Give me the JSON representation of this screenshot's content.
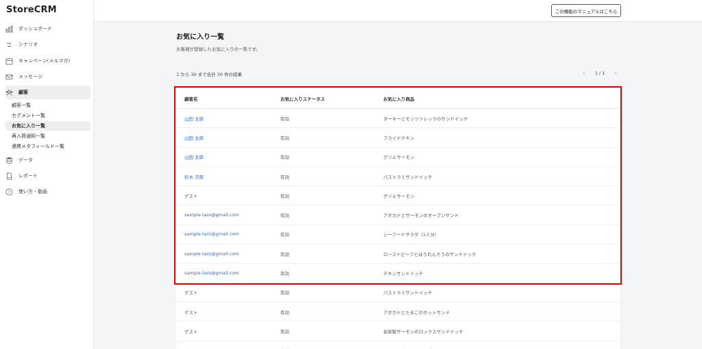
{
  "app": {
    "logo": "StoreCRM"
  },
  "sidebar": {
    "items": [
      {
        "label": "ダッシュボード",
        "icon": "bar-chart-icon"
      },
      {
        "label": "シナリオ",
        "icon": "scenario-icon"
      },
      {
        "label": "キャンペーン(メルマガ)",
        "icon": "calendar-icon"
      },
      {
        "label": "メッセージ",
        "icon": "mail-icon"
      },
      {
        "label": "顧客",
        "icon": "users-icon",
        "active": true
      },
      {
        "label": "データ",
        "icon": "database-icon"
      },
      {
        "label": "レポート",
        "icon": "report-icon"
      },
      {
        "label": "使い方・動画",
        "icon": "help-icon"
      }
    ],
    "sub_items": [
      {
        "label": "顧客一覧"
      },
      {
        "label": "セグメント一覧"
      },
      {
        "label": "お気に入り一覧",
        "active": true
      },
      {
        "label": "再入荷通知一覧"
      },
      {
        "label": "連携メタフィールド一覧"
      }
    ]
  },
  "topbar": {
    "manual_button": "この機能のマニュアルはこちら"
  },
  "main": {
    "title": "お気に入り一覧",
    "subtitle": "お客様が登録したお気に入りの一覧です。",
    "results_text": "1 から 30 まで合計 30 件の結果",
    "pager": {
      "prev": "<",
      "page": "1 / 1",
      "next": ">"
    }
  },
  "table": {
    "headers": [
      "顧客名",
      "お気に入りステータス",
      "お気に入り商品"
    ],
    "rows": [
      {
        "customer": "山田 太郎",
        "status": "有効",
        "product": "ターキーとモッツァレッラのサンドイッチ",
        "link": true
      },
      {
        "customer": "山田 太郎",
        "status": "有効",
        "product": "フライドチキン",
        "link": true
      },
      {
        "customer": "山田 太郎",
        "status": "有効",
        "product": "グリルサーモン",
        "link": true
      },
      {
        "customer": "鈴木 次郎",
        "status": "有効",
        "product": "パストラミサンドイッチ",
        "link": true
      },
      {
        "customer": "ゲスト",
        "status": "有効",
        "product": "グリルサーモン",
        "link": false
      },
      {
        "customer": "sample-taro@gmail.com",
        "status": "有効",
        "product": "アボカドとサーモンのオープンサンド",
        "link": true
      },
      {
        "customer": "sample-taro@gmail.com",
        "status": "有効",
        "product": "シーフードサラダ（2人分）",
        "link": true
      },
      {
        "customer": "sample-taro@gmail.com",
        "status": "有効",
        "product": "ローストビーフとほうれんそうのサンドイッチ",
        "link": true
      },
      {
        "customer": "sample-taro@gmail.com",
        "status": "有効",
        "product": "チキンサンドイッチ",
        "link": true
      },
      {
        "customer": "ゲスト",
        "status": "有効",
        "product": "パストラミサンドイッチ",
        "link": false
      },
      {
        "customer": "ゲスト",
        "status": "有効",
        "product": "アボカドとたまごのホットサンド",
        "link": false
      },
      {
        "customer": "ゲスト",
        "status": "有効",
        "product": "自家製サーモンのロックスサンドイッチ",
        "link": false
      },
      {
        "customer": "ゲスト",
        "status": "有効",
        "product": "ローストビーフとチーズのサンドイッチ",
        "link": false
      }
    ]
  },
  "colors": {
    "link": "#2a6bc4",
    "highlight": "#e00000",
    "active_bg": "#eceef1"
  }
}
